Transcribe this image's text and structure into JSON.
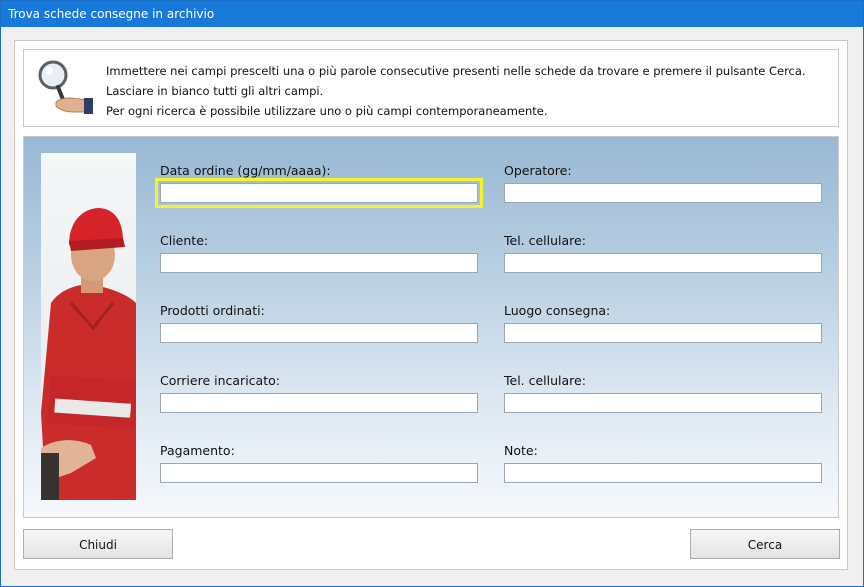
{
  "window": {
    "title": "Trova schede consegne in archivio"
  },
  "info": {
    "lines": [
      "Immettere nei campi prescelti una o più parole consecutive presenti nelle schede da trovare e premere il pulsante Cerca.",
      "Lasciare in bianco tutti gli altri campi.",
      "Per ogni ricerca è possibile utilizzare uno o più campi contemporaneamente."
    ]
  },
  "fields": {
    "data_ordine": {
      "label": "Data ordine (gg/mm/aaaa):",
      "value": ""
    },
    "operatore": {
      "label": "Operatore:",
      "value": ""
    },
    "cliente": {
      "label": "Cliente:",
      "value": ""
    },
    "tel_cellulare_1": {
      "label": "Tel. cellulare:",
      "value": ""
    },
    "prodotti_ordinati": {
      "label": "Prodotti ordinati:",
      "value": ""
    },
    "luogo_consegna": {
      "label": "Luogo consegna:",
      "value": ""
    },
    "corriere_incaricato": {
      "label": "Corriere incaricato:",
      "value": ""
    },
    "tel_cellulare_2": {
      "label": "Tel. cellulare:",
      "value": ""
    },
    "pagamento": {
      "label": "Pagamento:",
      "value": ""
    },
    "note": {
      "label": "Note:",
      "value": ""
    }
  },
  "buttons": {
    "close_label": "Chiudi",
    "search_label": "Cerca"
  },
  "colors": {
    "titlebar": "#1979db",
    "focus": "#f4f42a",
    "panel_top": "#98b8d4",
    "panel_bottom": "#f6f9fc"
  },
  "icons": {
    "info": "magnifier-icon",
    "photo": "delivery-courier-photo"
  }
}
